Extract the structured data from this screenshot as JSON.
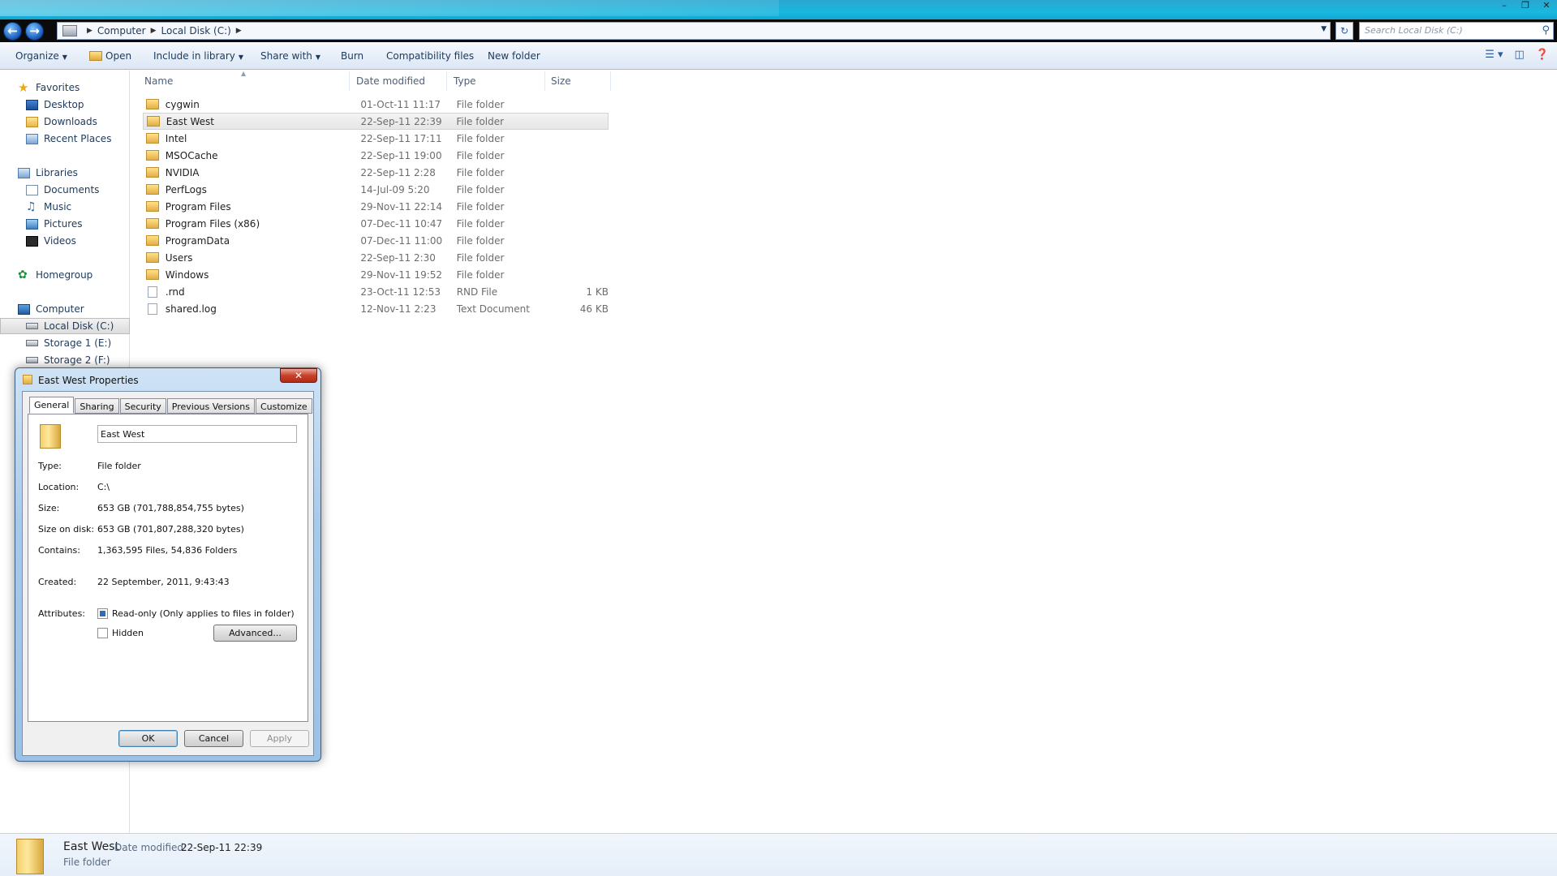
{
  "address": {
    "crumbs": [
      "Computer",
      "Local Disk (C:)"
    ],
    "search_placeholder": "Search Local Disk (C:)"
  },
  "toolbar": {
    "organize": "Organize",
    "open": "Open",
    "include_in_library": "Include in library",
    "share_with": "Share with",
    "burn": "Burn",
    "compatibility_files": "Compatibility files",
    "new_folder": "New folder"
  },
  "nav": {
    "favorites": "Favorites",
    "desktop": "Desktop",
    "downloads": "Downloads",
    "recent_places": "Recent Places",
    "libraries": "Libraries",
    "documents": "Documents",
    "music": "Music",
    "pictures": "Pictures",
    "videos": "Videos",
    "homegroup": "Homegroup",
    "computer": "Computer",
    "local_disk": "Local Disk (C:)",
    "storage1": "Storage 1 (E:)",
    "storage2": "Storage 2 (F:)"
  },
  "columns": {
    "name": "Name",
    "date": "Date modified",
    "type": "Type",
    "size": "Size"
  },
  "files": [
    {
      "name": "cygwin",
      "date": "01-Oct-11 11:17",
      "type": "File folder",
      "size": ""
    },
    {
      "name": "East West",
      "date": "22-Sep-11 22:39",
      "type": "File folder",
      "size": ""
    },
    {
      "name": "Intel",
      "date": "22-Sep-11 17:11",
      "type": "File folder",
      "size": ""
    },
    {
      "name": "MSOCache",
      "date": "22-Sep-11 19:00",
      "type": "File folder",
      "size": ""
    },
    {
      "name": "NVIDIA",
      "date": "22-Sep-11 2:28",
      "type": "File folder",
      "size": ""
    },
    {
      "name": "PerfLogs",
      "date": "14-Jul-09 5:20",
      "type": "File folder",
      "size": ""
    },
    {
      "name": "Program Files",
      "date": "29-Nov-11 22:14",
      "type": "File folder",
      "size": ""
    },
    {
      "name": "Program Files (x86)",
      "date": "07-Dec-11 10:47",
      "type": "File folder",
      "size": ""
    },
    {
      "name": "ProgramData",
      "date": "07-Dec-11 11:00",
      "type": "File folder",
      "size": ""
    },
    {
      "name": "Users",
      "date": "22-Sep-11 2:30",
      "type": "File folder",
      "size": ""
    },
    {
      "name": "Windows",
      "date": "29-Nov-11 19:52",
      "type": "File folder",
      "size": ""
    },
    {
      "name": ".rnd",
      "date": "23-Oct-11 12:53",
      "type": "RND File",
      "size": "1 KB"
    },
    {
      "name": "shared.log",
      "date": "12-Nov-11 2:23",
      "type": "Text Document",
      "size": "46 KB"
    }
  ],
  "details": {
    "name": "East West",
    "date_label": "Date modified:",
    "date_value": "22-Sep-11 22:39",
    "type": "File folder"
  },
  "dialog": {
    "title": "East West Properties",
    "tabs": [
      "General",
      "Sharing",
      "Security",
      "Previous Versions",
      "Customize"
    ],
    "folder_name": "East West",
    "type_label": "Type:",
    "type_value": "File folder",
    "location_label": "Location:",
    "location_value": "C:\\",
    "size_label": "Size:",
    "size_value": "653 GB (701,788,854,755 bytes)",
    "size_on_disk_label": "Size on disk:",
    "size_on_disk_value": "653 GB (701,807,288,320 bytes)",
    "contains_label": "Contains:",
    "contains_value": "1,363,595 Files, 54,836 Folders",
    "created_label": "Created:",
    "created_value": "22 September, 2011, 9:43:43",
    "attributes_label": "Attributes:",
    "readonly_label": "Read-only (Only applies to files in folder)",
    "hidden_label": "Hidden",
    "advanced_label": "Advanced...",
    "ok_label": "OK",
    "cancel_label": "Cancel",
    "apply_label": "Apply"
  }
}
